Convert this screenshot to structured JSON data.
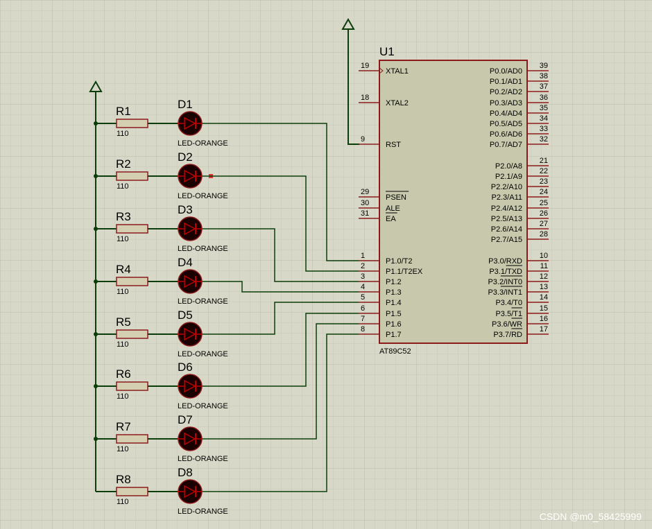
{
  "colors": {
    "background": "#d8d8c8",
    "grid_minor": "#c9c9b8",
    "grid_major": "#bdbdab",
    "wire": "#0b3d0b",
    "body_border": "#8b1a1a",
    "chip_fill": "#c8c8ac",
    "resistor_fill": "#d3cfb0",
    "led_fill": "#1a0000",
    "led_triangle": "#c00000",
    "junction": "#0b3d0b",
    "text": "#000000",
    "watermark": "#ffffff"
  },
  "chip": {
    "ref": "U1",
    "part": "AT89C52",
    "left_pins": [
      {
        "num": "19",
        "name": "XTAL1",
        "clock": true
      },
      {
        "num": "18",
        "name": "XTAL2"
      },
      {
        "num": "9",
        "name": "RST"
      },
      {
        "num": "29",
        "name": "PSEN",
        "overbar": true
      },
      {
        "num": "30",
        "name": "ALE"
      },
      {
        "num": "31",
        "name": "EA",
        "overbar": true
      },
      {
        "num": "1",
        "name": "P1.0/T2"
      },
      {
        "num": "2",
        "name": "P1.1/T2EX"
      },
      {
        "num": "3",
        "name": "P1.2"
      },
      {
        "num": "4",
        "name": "P1.3"
      },
      {
        "num": "5",
        "name": "P1.4"
      },
      {
        "num": "6",
        "name": "P1.5"
      },
      {
        "num": "7",
        "name": "P1.6"
      },
      {
        "num": "8",
        "name": "P1.7"
      }
    ],
    "right_pins": [
      {
        "num": "39",
        "name": "P0.0/AD0"
      },
      {
        "num": "38",
        "name": "P0.1/AD1"
      },
      {
        "num": "37",
        "name": "P0.2/AD2"
      },
      {
        "num": "36",
        "name": "P0.3/AD3"
      },
      {
        "num": "35",
        "name": "P0.4/AD4"
      },
      {
        "num": "34",
        "name": "P0.5/AD5"
      },
      {
        "num": "33",
        "name": "P0.6/AD6"
      },
      {
        "num": "32",
        "name": "P0.7/AD7"
      },
      {
        "num": "21",
        "name": "P2.0/A8"
      },
      {
        "num": "22",
        "name": "P2.1/A9"
      },
      {
        "num": "23",
        "name": "P2.2/A10"
      },
      {
        "num": "24",
        "name": "P2.3/A11"
      },
      {
        "num": "25",
        "name": "P2.4/A12"
      },
      {
        "num": "26",
        "name": "P2.5/A13"
      },
      {
        "num": "27",
        "name": "P2.6/A14"
      },
      {
        "num": "28",
        "name": "P2.7/A15"
      },
      {
        "num": "10",
        "name": "P3.0/RXD"
      },
      {
        "num": "11",
        "name": "P3.1/TXD",
        "prefix": "P3.1/",
        "ovl": "TXD"
      },
      {
        "num": "12",
        "name": "P3.2/INT0",
        "prefix": "P3.2/",
        "ovl": "INT0"
      },
      {
        "num": "13",
        "name": "P3.3/INT1",
        "prefix": "P3.3/",
        "ovl": "INT1"
      },
      {
        "num": "14",
        "name": "P3.4/T0"
      },
      {
        "num": "15",
        "name": "P3.5/T1",
        "prefix": "P3.5/",
        "ovl": "T1"
      },
      {
        "num": "16",
        "name": "P3.6/WR",
        "prefix": "P3.6/",
        "ovl": "WR"
      },
      {
        "num": "17",
        "name": "P3.7/RD",
        "prefix": "P3.7/",
        "ovl": "RD"
      }
    ]
  },
  "branches": [
    {
      "resistor": "R1",
      "value": "110",
      "led": "D1",
      "led_part": "LED-ORANGE"
    },
    {
      "resistor": "R2",
      "value": "110",
      "led": "D2",
      "led_part": "LED-ORANGE"
    },
    {
      "resistor": "R3",
      "value": "110",
      "led": "D3",
      "led_part": "LED-ORANGE"
    },
    {
      "resistor": "R4",
      "value": "110",
      "led": "D4",
      "led_part": "LED-ORANGE"
    },
    {
      "resistor": "R5",
      "value": "110",
      "led": "D5",
      "led_part": "LED-ORANGE"
    },
    {
      "resistor": "R6",
      "value": "110",
      "led": "D6",
      "led_part": "LED-ORANGE"
    },
    {
      "resistor": "R7",
      "value": "110",
      "led": "D7",
      "led_part": "LED-ORANGE"
    },
    {
      "resistor": "R8",
      "value": "110",
      "led": "D8",
      "led_part": "LED-ORANGE"
    }
  ],
  "power_terminals": [
    "left-rail-power",
    "rst-power"
  ],
  "watermark": "CSDN @m0_58425999"
}
